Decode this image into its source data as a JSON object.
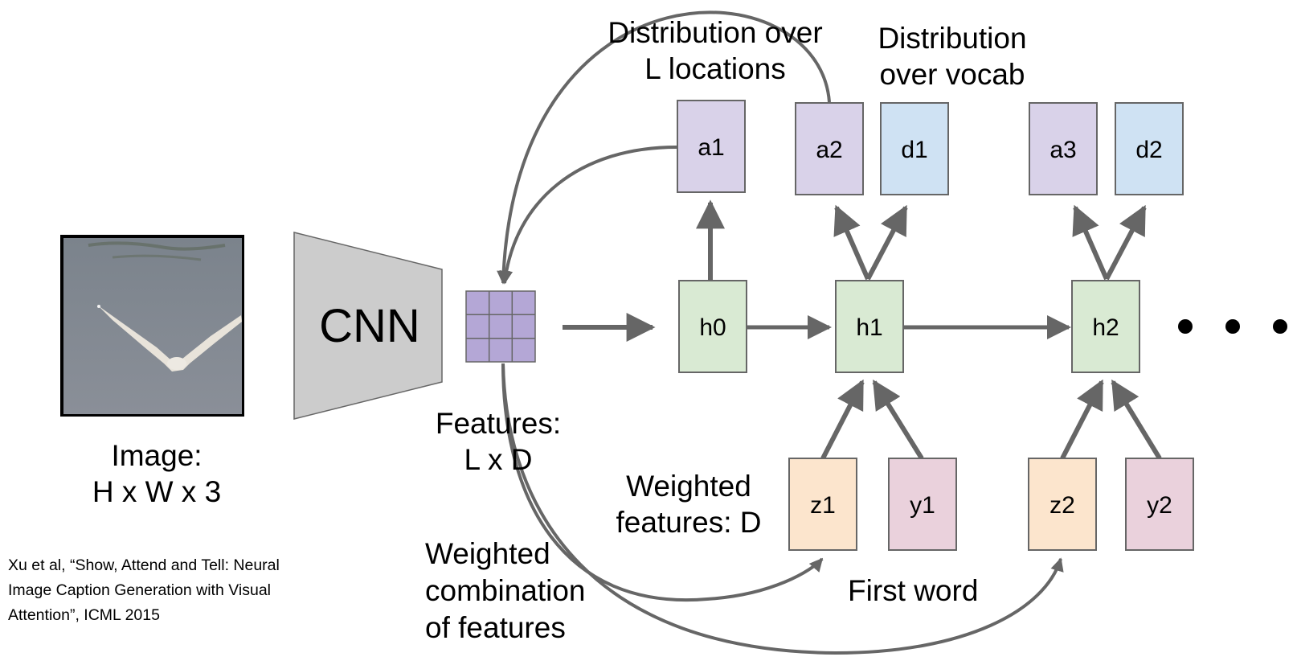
{
  "colors": {
    "arrow": "#666666",
    "box_border": "#666666",
    "attention_box": "#d9d2e9",
    "vocab_box": "#cfe2f3",
    "hidden_box": "#d9ead3",
    "weighted_box": "#fce5cd",
    "word_box": "#ead1dc",
    "feature_grid": "#b4a7d6",
    "cnn": "#cccccc",
    "image_water": "#7d8590"
  },
  "image": {
    "label_line1": "Image:",
    "label_line2": "H x W x 3"
  },
  "cnn": {
    "label": "CNN"
  },
  "features": {
    "label_line1": "Features:",
    "label_line2": "L x D"
  },
  "boxes": {
    "a1": "a1",
    "a2": "a2",
    "d1": "d1",
    "a3": "a3",
    "d2": "d2",
    "h0": "h0",
    "h1": "h1",
    "h2": "h2",
    "z1": "z1",
    "y1": "y1",
    "z2": "z2",
    "y2": "y2"
  },
  "annotations": {
    "dist_locations_line1": "Distribution over",
    "dist_locations_line2": "L locations",
    "dist_vocab_line1": "Distribution",
    "dist_vocab_line2": "over vocab",
    "weighted_features_line1": "Weighted",
    "weighted_features_line2": "features: D",
    "weighted_combination_line1": "Weighted",
    "weighted_combination_line2": "combination",
    "weighted_combination_line3": "of features",
    "first_word": "First word"
  },
  "citation": {
    "line1": "Xu et al, “Show, Attend and Tell: Neural",
    "line2": "Image Caption Generation with Visual",
    "line3": "Attention”, ICML 2015"
  }
}
